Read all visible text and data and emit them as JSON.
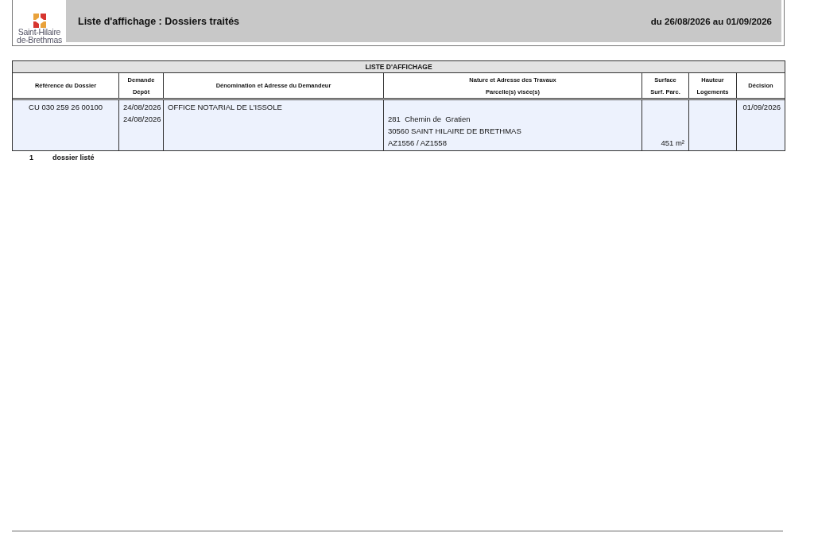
{
  "header": {
    "logo_text": [
      "Saint-Hilaire",
      "de-Brethmas"
    ],
    "title": "Liste d'affichage : Dossiers traités",
    "period": "du 26/08/2026 au 01/09/2026"
  },
  "table": {
    "title": "LISTE D'AFFICHAGE",
    "columns": [
      {
        "lines": [
          "Référence du Dossier"
        ]
      },
      {
        "lines": [
          "Demande",
          "Dépôt"
        ]
      },
      {
        "lines": [
          "Dénomination et Adresse du Demandeur"
        ]
      },
      {
        "lines": [
          "Nature et Adresse des Travaux",
          "Parcelle(s) visée(s)"
        ]
      },
      {
        "lines": [
          "Surface",
          "Surf. Parc."
        ]
      },
      {
        "lines": [
          "Hauteur",
          "Logements"
        ]
      },
      {
        "lines": [
          "Décision"
        ]
      }
    ],
    "rows": [
      {
        "reference": "CU 030 259 26 00100",
        "demande": "24/08/2026",
        "depot": "24/08/2026",
        "demandeur": "OFFICE NOTARIAL DE L'ISSOLE",
        "adresse_travaux": [
          "281  Chemin de  Gratien",
          "30560 SAINT HILAIRE DE BRETHMAS"
        ],
        "parcelles": "AZ1556 / AZ1558",
        "surface_parcelle": "451 m²",
        "decision": "01/09/2026"
      }
    ]
  },
  "summary": {
    "count": "1",
    "label": "dossier listé"
  }
}
